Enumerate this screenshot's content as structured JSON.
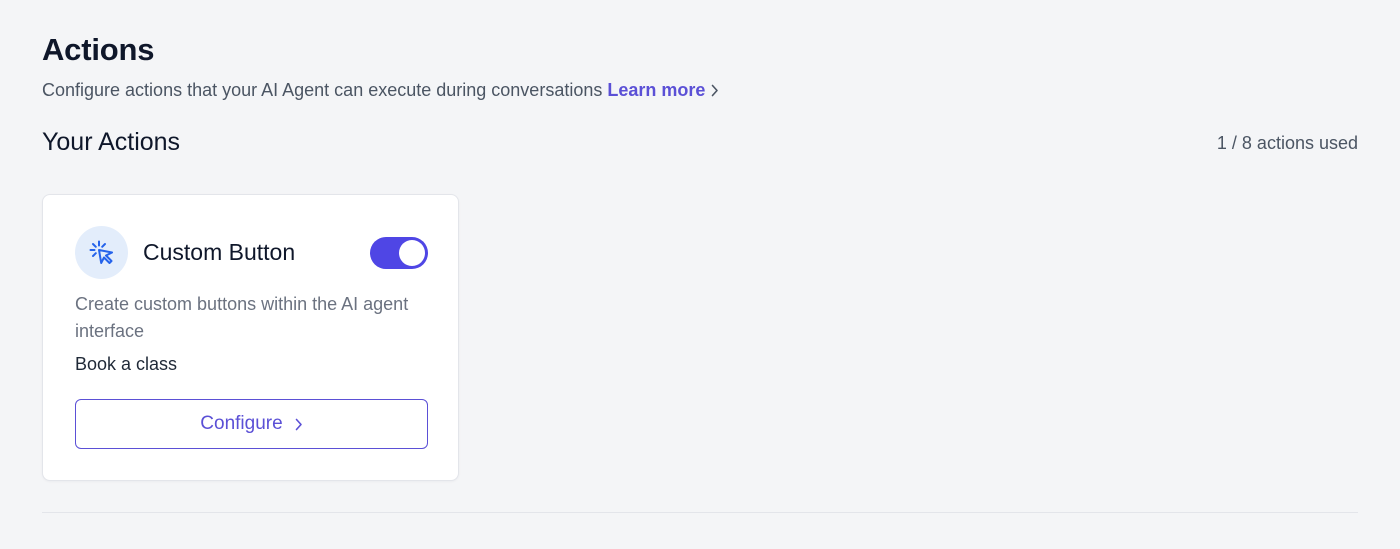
{
  "header": {
    "title": "Actions",
    "subtitle": "Configure actions that your AI Agent can execute during conversations",
    "learn_more": "Learn more"
  },
  "section": {
    "title": "Your Actions",
    "usage": "1 / 8 actions used"
  },
  "actions": [
    {
      "icon": "cursor-click-icon",
      "title": "Custom Button",
      "enabled": true,
      "description": "Create custom buttons within the AI agent interface",
      "value": "Book a class",
      "button_label": "Configure"
    }
  ],
  "colors": {
    "accent": "#4f46e5",
    "link": "#5b50d6",
    "icon_bg": "#e3edfb",
    "icon_fg": "#2563eb",
    "page_bg": "#f4f5f7"
  }
}
